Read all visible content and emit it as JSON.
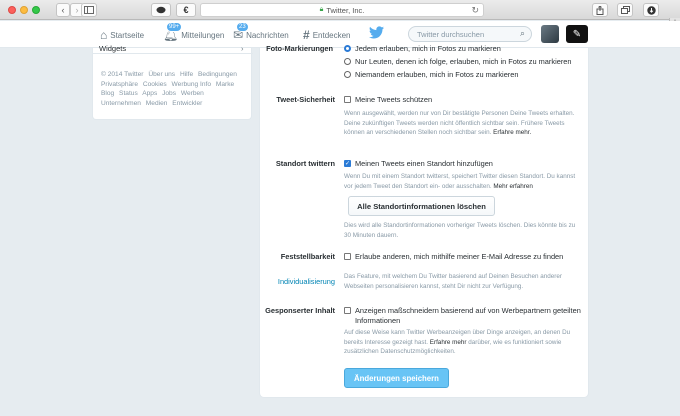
{
  "browser": {
    "address": "Twitter, Inc.",
    "chat_icon": "chat-bubble-icon",
    "euro_icon": "euro-icon"
  },
  "nav": {
    "home": "Startseite",
    "mentions": "Mitteilungen",
    "mentions_badge": "99+",
    "messages": "Nachrichten",
    "messages_badge": "23",
    "discover": "Entdecken",
    "search_placeholder": "Twitter durchsuchen"
  },
  "left": {
    "widgets": "Widgets",
    "footer": [
      "© 2014 Twitter",
      "Über uns",
      "Hilfe",
      "Bedingungen",
      "Privatsphäre",
      "Cookies",
      "Werbung Info",
      "Marke",
      "Blog",
      "Status",
      "Apps",
      "Jobs",
      "Werben",
      "Unternehmen",
      "Medien",
      "Entwickler"
    ]
  },
  "settings": {
    "photo_label": "Foto-Markierungen",
    "photo_options": [
      "Jedem erlauben, mich in Fotos zu markieren",
      "Nur Leuten, denen ich folge, erlauben, mich in Fotos zu markieren",
      "Niemandem erlauben, mich in Fotos zu markieren"
    ],
    "privacy_label": "Tweet-Sicherheit",
    "privacy_option": "Meine Tweets schützen",
    "privacy_help": "Wenn ausgewählt, werden nur von Dir bestätigte Personen Deine Tweets erhalten. Deine zukünftigen Tweets werden nicht öffentlich sichtbar sein. Frühere Tweets können an verschiedenen Stellen noch sichtbar sein.",
    "privacy_more": "Erfahre mehr.",
    "location_label": "Standort twittern",
    "location_option": "Meinen Tweets einen Standort hinzufügen",
    "location_help": "Wenn Du mit einem Standort twitterst, speichert Twitter diesen Standort. Du kannst vor jedem Tweet den Standort ein- oder ausschalten.",
    "location_more": "Mehr erfahren",
    "delete_location_button": "Alle Standortinformationen löschen",
    "delete_help": "Dies wird alle Standortinformationen vorheriger Tweets löschen. Dies könnte bis zu 30 Minuten dauern.",
    "findability_label": "Feststellbarkeit",
    "findability_option": "Erlaube anderen, mich mithilfe meiner E-Mail Adresse zu finden",
    "personalization_label": "Individualisierung",
    "personalization_help": "Das Feature, mit welchem Du Twitter basierend auf Deinen Besuchen anderer Webseiten personalisieren kannst, steht Dir nicht zur Verfügung.",
    "ads_label": "Gesponserter Inhalt",
    "ads_option": "Anzeigen maßschneidern basierend auf von Werbepartnern geteilten Informationen",
    "ads_help_1": "Auf diese Weise kann Twitter Werbeanzeigen über Dinge anzeigen, an denen Du bereits Interesse gezeigt hast.",
    "ads_more": "Erfahre mehr",
    "ads_help_2": "darüber, wie es funktioniert sowie zusätzlichen Datenschutzmöglichkeiten.",
    "save_button": "Änderungen speichern"
  }
}
